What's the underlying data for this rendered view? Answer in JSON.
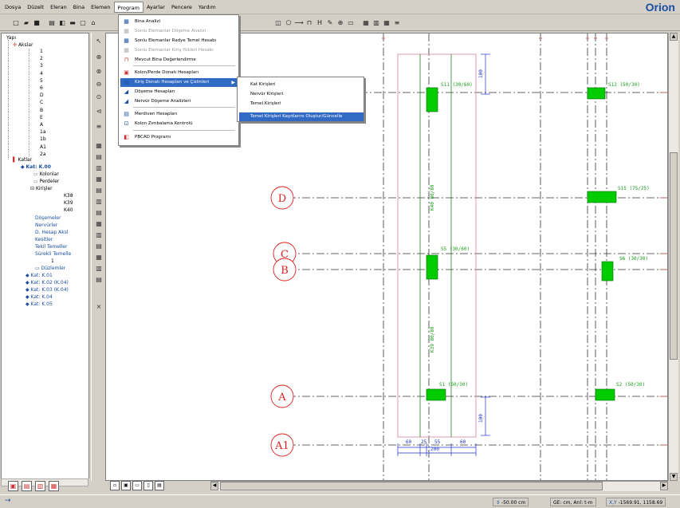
{
  "brand": "Orion",
  "menubar": [
    "Dosya",
    "Düzelt",
    "Eleran",
    "Bina",
    "Elemen",
    "Program",
    "Ayarlar",
    "Pencere",
    "Yardım"
  ],
  "tree": {
    "root": "Yapı",
    "axes_label": "Akslar",
    "axes": [
      "1",
      "2",
      "3",
      "4",
      "5",
      "6",
      "D",
      "C",
      "B",
      "E",
      "A",
      "1a",
      "1b",
      "A1",
      "2a"
    ],
    "floors_label": "Katlar",
    "current_floor": "Kat: K.00",
    "floor_children": [
      "Kolonlar",
      "Perdeler"
    ],
    "beams_label": "Kirişler",
    "beams": [
      "K38",
      "K39",
      "K40"
    ],
    "more": [
      "Döşemeler",
      "Nervürler",
      "D. Hesap Aksl",
      "Kesitler",
      "Tekil Temeller",
      "Sürekli Temelle"
    ],
    "sub_one": "1",
    "duzlemler": "Düzlemler",
    "other_floors": [
      "Kat: K.01",
      "Kat: K.02 (K.04)",
      "Kat: K.03 (K.04)",
      "Kat: K.04",
      "Kat: K.05"
    ]
  },
  "menu": {
    "items": [
      {
        "label": "Bina Analizi",
        "icon": "building-icon",
        "disabled": false
      },
      {
        "label": "Sonlu Elemanlar Döşeme Analizi",
        "icon": "grid-icon",
        "disabled": true
      },
      {
        "label": "Sonlu Elemanlar Radye Temel Hesabı",
        "icon": "grid-icon",
        "disabled": false
      },
      {
        "label": "Sonlu Elemanlar Kiriş Yükleri Hesabı",
        "icon": "grid-icon",
        "disabled": true
      },
      {
        "label": "Mevcut Bina Değerlendirme",
        "icon": "frame-icon",
        "disabled": false
      },
      {
        "label": "Kolon/Perde Donatı Hesapları",
        "icon": "column-icon",
        "disabled": false
      },
      {
        "label": "Kiriş Donatı Hesapları ve Çizimleri",
        "icon": "beam-icon",
        "disabled": false,
        "selected": true
      },
      {
        "label": "Döşeme Hesapları",
        "icon": "slab-icon",
        "disabled": false
      },
      {
        "label": "Nervür Döşeme Analizleri",
        "icon": "slab-icon",
        "disabled": false
      },
      {
        "label": "Merdiven Hesapları",
        "icon": "stair-icon",
        "disabled": false
      },
      {
        "label": "Kolon Zımbalama Kontrolü",
        "icon": "punch-icon",
        "disabled": false
      },
      {
        "label": "PBCAD Programı",
        "icon": "cad-icon",
        "disabled": false
      }
    ]
  },
  "submenu": {
    "items": [
      "Kat Kirişleri",
      "Nervür Kirişleri",
      "Temel Kirişleri",
      "Temel Kirişleri Kayıtlarını Oluştur/Güncelle"
    ],
    "selected_index": 3
  },
  "drawing": {
    "axis_labels": [
      "D",
      "C",
      "B",
      "A",
      "A1"
    ],
    "column_labels": [
      "S11 (30/60)",
      "S12 (50/30)",
      "S15 (75/25)",
      "S5 (30/60)",
      "S6 (30/30)",
      "S1 (50/30)",
      "S2 (50/30)"
    ],
    "beam_labels": [
      "K40 80/80",
      "K39 80/80"
    ],
    "dims_bottom": [
      "60",
      "25",
      "55",
      "60",
      "200"
    ],
    "dims_vert": [
      "100",
      "100"
    ]
  },
  "status": {
    "elevation": "-50.00 cm",
    "units": "GE: cm, Arıl: t-m",
    "coord_label": "X,Y",
    "coords": "-1569.91, 1158.69"
  },
  "colors": {
    "accent": "#316ac5",
    "column_fill": "#00cc00",
    "axis_circle": "#d22",
    "beam_line": "#2a7d2a",
    "dim": "#2233cc"
  }
}
